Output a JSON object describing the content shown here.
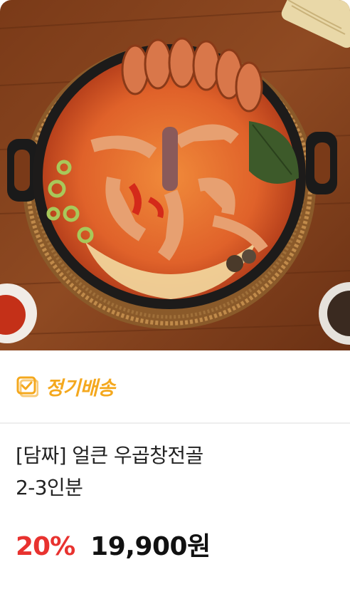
{
  "product": {
    "image_alt_icon": "food-photo",
    "badge_icon": "calendar-check-icon",
    "badge_label": "정기배송",
    "title_line1": "[담짜] 얼큰 우곱창전골",
    "title_line2": "2-3인분",
    "discount": "20%",
    "price": "19,900원"
  },
  "colors": {
    "badge": "#f4a81e",
    "discount": "#e8322f",
    "price": "#111111"
  }
}
